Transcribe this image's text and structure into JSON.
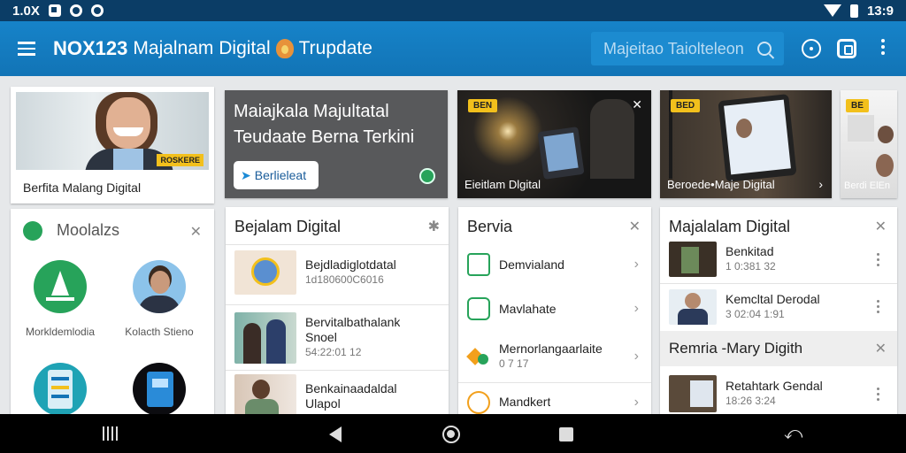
{
  "status_bar": {
    "left_text": "1.0X",
    "time": "13:9"
  },
  "app_bar": {
    "brand": "NOX123",
    "title_rest": "Majalnam Digital",
    "title_suffix": "Trupdate",
    "search_placeholder": "Majeitao Taiolteleon"
  },
  "colors": {
    "app_bar": "#1479bd",
    "status_bar": "#0b3d66",
    "accent_green": "#27a35a",
    "badge_yellow": "#f2c01c"
  },
  "hero": {
    "caption": "Berfita Malang Digital",
    "badge": "ROSKERE",
    "headline_line1": "Maiajkala Majultatal",
    "headline_line2": "Teudaate Berna Terkini",
    "cta": "Berlieleat"
  },
  "tiles": [
    {
      "tag": "BEN",
      "caption": "Eieitlam Dlgital"
    },
    {
      "tag": "BED",
      "caption": "Beroede•Maje Digital"
    },
    {
      "tag": "BE",
      "caption": "Berdi ElEn"
    }
  ],
  "mobile_card": {
    "title": "Moolalzs",
    "items": [
      {
        "label": "Morkldemlodia",
        "icon": "sailboat-icon"
      },
      {
        "label": "Kolacth Stieno",
        "icon": "person-avatar"
      }
    ]
  },
  "list_col1": {
    "title": "Bejalam Digital",
    "rows": [
      {
        "title": "Bejdladiglotdatal",
        "meta": "1d180600C6016"
      },
      {
        "title": "Bervitalbathalank",
        "subtitle": "Snoel",
        "meta": "54:22:01 12"
      },
      {
        "title": "Benkainaadaldal",
        "subtitle": "Ulapol",
        "meta": ""
      }
    ]
  },
  "list_col2": {
    "title": "Bervia",
    "rows": [
      {
        "title": "Demvialand",
        "icon": "calendar-icon"
      },
      {
        "title": "Mavlahate",
        "icon": "chat-icon"
      },
      {
        "title": "Mernorlangaarlaite",
        "subtitle": "0 7 17",
        "icon": "sparkle-icon"
      },
      {
        "title": "Mandkert",
        "icon": "coin-icon"
      }
    ]
  },
  "list_col3": {
    "title": "Majalalam Digital",
    "rows": [
      {
        "title": "Benkitad",
        "meta": "1 0:381 32"
      },
      {
        "title": "Kemcltal Derodal",
        "meta": "3 02:04 1:91"
      }
    ],
    "section2_title": "Remria -Mary Digith",
    "section2_rows": [
      {
        "title": "Retahtark Gendal",
        "meta": "18:26 3:24"
      }
    ]
  }
}
